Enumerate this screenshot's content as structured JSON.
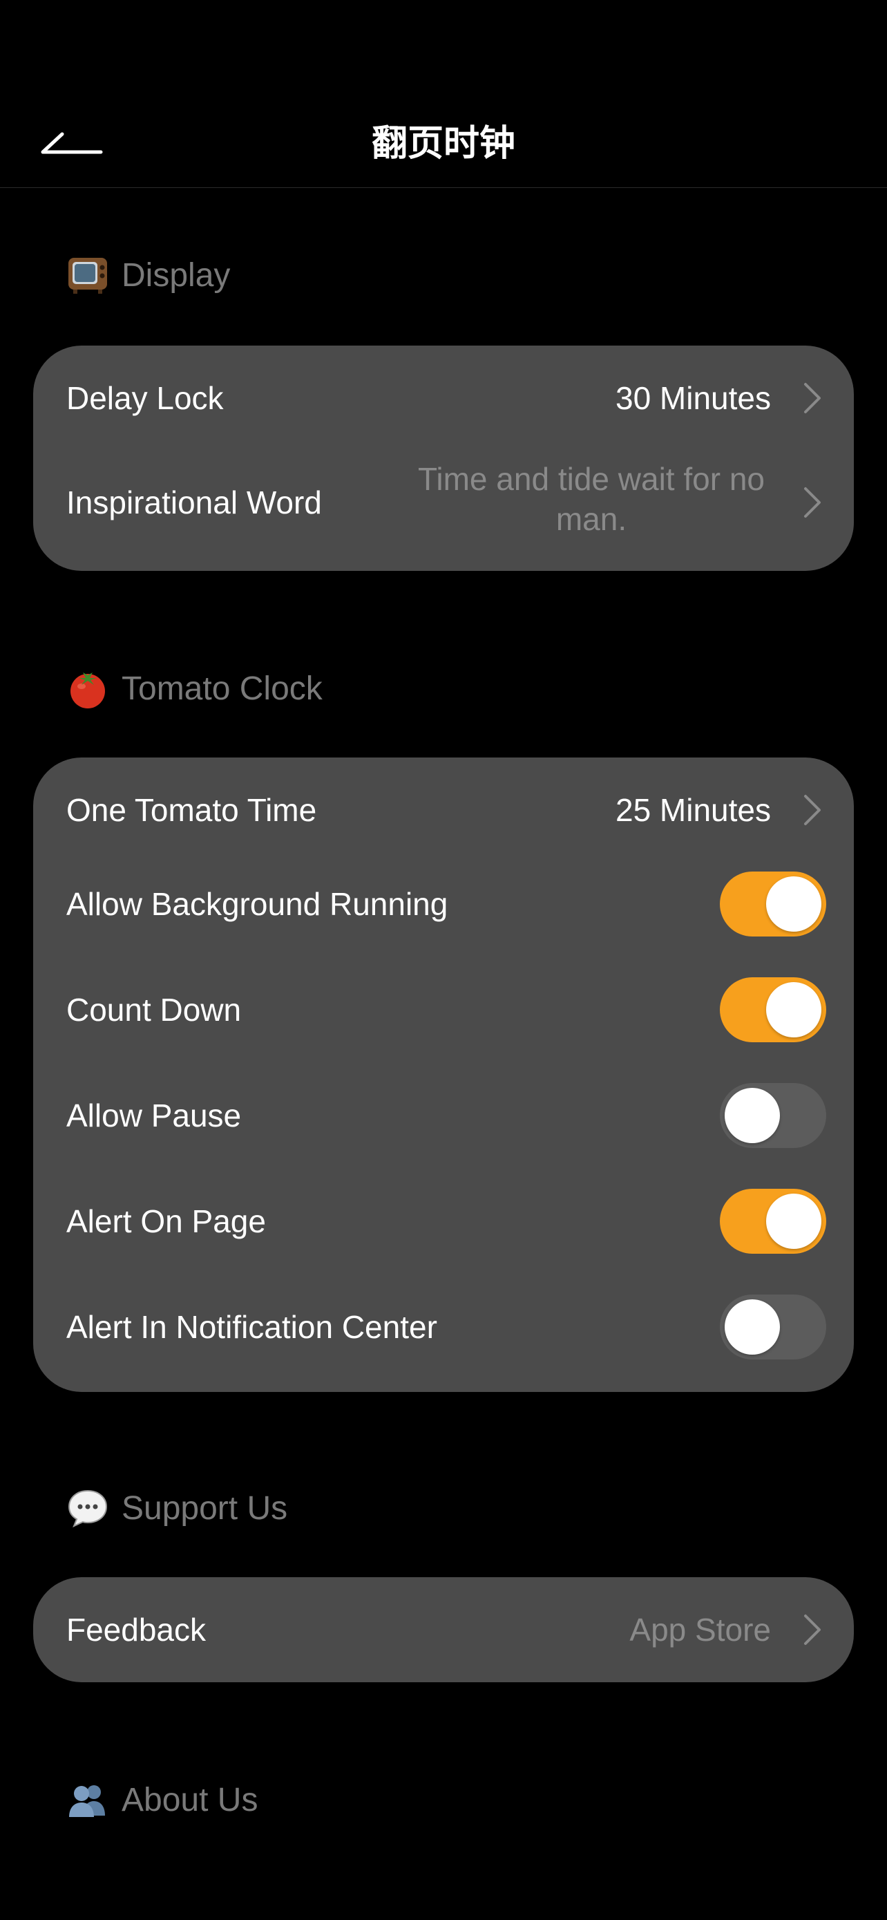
{
  "nav": {
    "title": "翻页时钟",
    "back_icon": "back-arrow-icon"
  },
  "sections": {
    "display": {
      "icon": "tv-icon",
      "header": "Display",
      "rows": {
        "delay_lock": {
          "label": "Delay Lock",
          "value": "30 Minutes"
        },
        "inspirational_word": {
          "label": "Inspirational Word",
          "value": "Time and tide wait for no man."
        }
      }
    },
    "tomato": {
      "icon": "tomato-icon",
      "header": "Tomato Clock",
      "rows": {
        "one_tomato_time": {
          "label": "One Tomato Time",
          "value": "25 Minutes"
        },
        "allow_background_running": {
          "label": "Allow Background Running",
          "on": true
        },
        "count_down": {
          "label": "Count Down",
          "on": true
        },
        "allow_pause": {
          "label": "Allow Pause",
          "on": false
        },
        "alert_on_page": {
          "label": "Alert On Page",
          "on": true
        },
        "alert_notification_center": {
          "label": "Alert In Notification Center",
          "on": false
        }
      }
    },
    "support": {
      "icon": "speech-bubble-icon",
      "header": "Support Us",
      "rows": {
        "feedback": {
          "label": "Feedback",
          "value": "App Store"
        }
      }
    },
    "about": {
      "icon": "people-icon",
      "header": "About Us"
    }
  },
  "colors": {
    "background": "#000000",
    "card": "#4b4b4b",
    "accent": "#f7a01d",
    "toggle_off": "#5c5c5c",
    "secondary_text": "#8a8a8a"
  }
}
